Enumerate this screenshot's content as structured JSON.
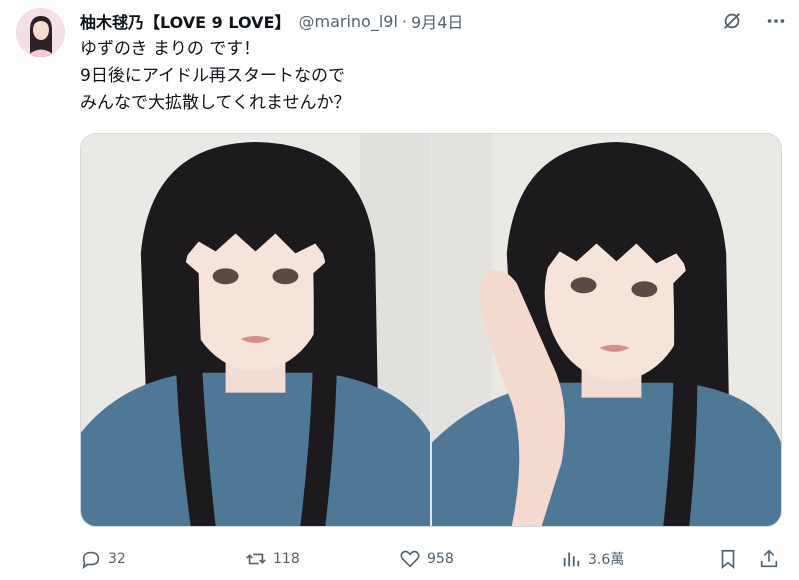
{
  "post": {
    "display_name": "柚木毬乃【LOVE 9 LOVE】",
    "handle": "@marino_l9l",
    "separator": "·",
    "date": "9月4日",
    "text_lines": [
      "ゆずのき まりの です！",
      "9日後にアイドル再スタートなので",
      "みんなで大拡散してくれませんか？"
    ]
  },
  "metrics": {
    "replies": "32",
    "reposts": "118",
    "likes": "958",
    "views": "3.6萬"
  },
  "icons": {
    "grok": "grok-icon",
    "more": "more-icon",
    "reply": "reply-icon",
    "repost": "repost-icon",
    "like": "heart-icon",
    "views": "views-icon",
    "bookmark": "bookmark-icon",
    "share": "share-icon"
  },
  "colors": {
    "text": "#0f1419",
    "secondary": "#536471",
    "shirt": "#4f7897",
    "hair": "#1c1a1c",
    "background": "#ffffff"
  }
}
